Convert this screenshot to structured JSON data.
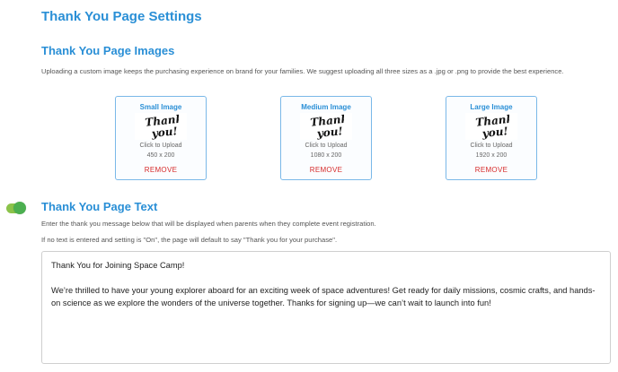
{
  "page": {
    "title": "Thank You Page Settings"
  },
  "images_section": {
    "title": "Thank You Page Images",
    "description": "Uploading a custom image keeps the purchasing experience on brand for your families. We suggest uploading all three sizes as a .jpg or .png to provide the best experience.",
    "cards": [
      {
        "label": "Small Image",
        "thumb_text_line1": "Thank",
        "thumb_text_line2": "you!",
        "upload_text": "Click to Upload",
        "size": "450 x 200",
        "remove_label": "REMOVE"
      },
      {
        "label": "Medium Image",
        "thumb_text_line1": "Thank",
        "thumb_text_line2": "you!",
        "upload_text": "Click to Upload",
        "size": "1080 x 200",
        "remove_label": "REMOVE"
      },
      {
        "label": "Large Image",
        "thumb_text_line1": "Thank",
        "thumb_text_line2": "you!",
        "upload_text": "Click to Upload",
        "size": "1920 x 200",
        "remove_label": "REMOVE"
      }
    ]
  },
  "text_section": {
    "title": "Thank You Page Text",
    "toggle_on": true,
    "instruction_1": "Enter the thank you message below that will be displayed when parents when they complete event registration.",
    "instruction_2": "If no text is entered and setting is \"On\", the page will default to say \"Thank you for your purchase\".",
    "message": "Thank You for Joining Space Camp!\n\nWe’re thrilled to have your young explorer aboard for an exciting week of space adventures! Get ready for daily missions, cosmic crafts, and hands-on science as we explore the wonders of the universe together. Thanks for signing up—we can’t wait to launch into fun!"
  },
  "colors": {
    "accent": "#2a8fd6",
    "remove": "#d62a2a",
    "toggle": "#4caf50"
  }
}
